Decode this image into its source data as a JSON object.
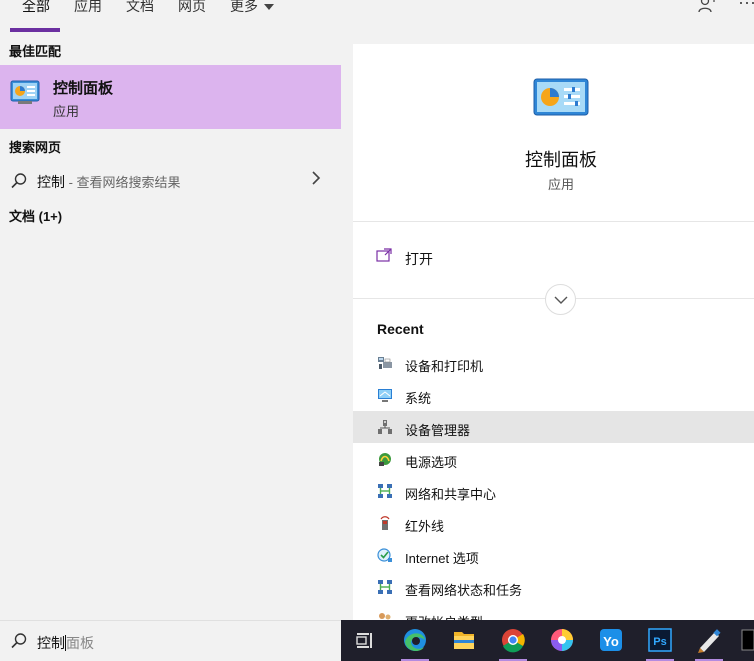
{
  "tabs": [
    {
      "label": "全部",
      "active": true
    },
    {
      "label": "应用"
    },
    {
      "label": "文档"
    },
    {
      "label": "网页"
    },
    {
      "label": "更多"
    }
  ],
  "top_icons": {
    "feedback": "person-feedback-icon",
    "more": "···"
  },
  "left": {
    "best_match_title": "最佳匹配",
    "best_match": {
      "title": "控制面板",
      "subtitle": "应用",
      "icon": "control-panel-icon"
    },
    "web_title": "搜索网页",
    "web_result": {
      "query": "控制",
      "suffix": " - 查看网络搜索结果"
    },
    "docs_title": "文档 (1+)"
  },
  "right": {
    "app_name": "控制面板",
    "app_type": "应用",
    "open_label": "打开",
    "recent_title": "Recent",
    "recent": [
      {
        "label": "设备和打印机",
        "icon": "printer-icon"
      },
      {
        "label": "系统",
        "icon": "monitor-icon"
      },
      {
        "label": "设备管理器",
        "icon": "device-manager-icon",
        "hover": true
      },
      {
        "label": "电源选项",
        "icon": "power-options-icon"
      },
      {
        "label": "网络和共享中心",
        "icon": "network-icon"
      },
      {
        "label": "红外线",
        "icon": "infrared-icon"
      },
      {
        "label": "Internet 选项",
        "icon": "internet-options-icon"
      },
      {
        "label": "查看网络状态和任务",
        "icon": "network-icon"
      },
      {
        "label": "更改帐户类型",
        "icon": "users-icon"
      }
    ]
  },
  "search": {
    "typed": "控制",
    "ghost": "面板"
  },
  "taskbar": [
    "task-view-icon",
    "edge-icon",
    "file-explorer-icon",
    "chrome-icon",
    "pinwheel-app-icon",
    "yo-app-icon",
    "photoshop-icon",
    "pen-app-icon",
    "terminal-icon"
  ],
  "colors": {
    "accent": "#6b2fa0",
    "selected_bg": "#dcb4ee",
    "taskbar_bg": "#1f1f2b"
  }
}
